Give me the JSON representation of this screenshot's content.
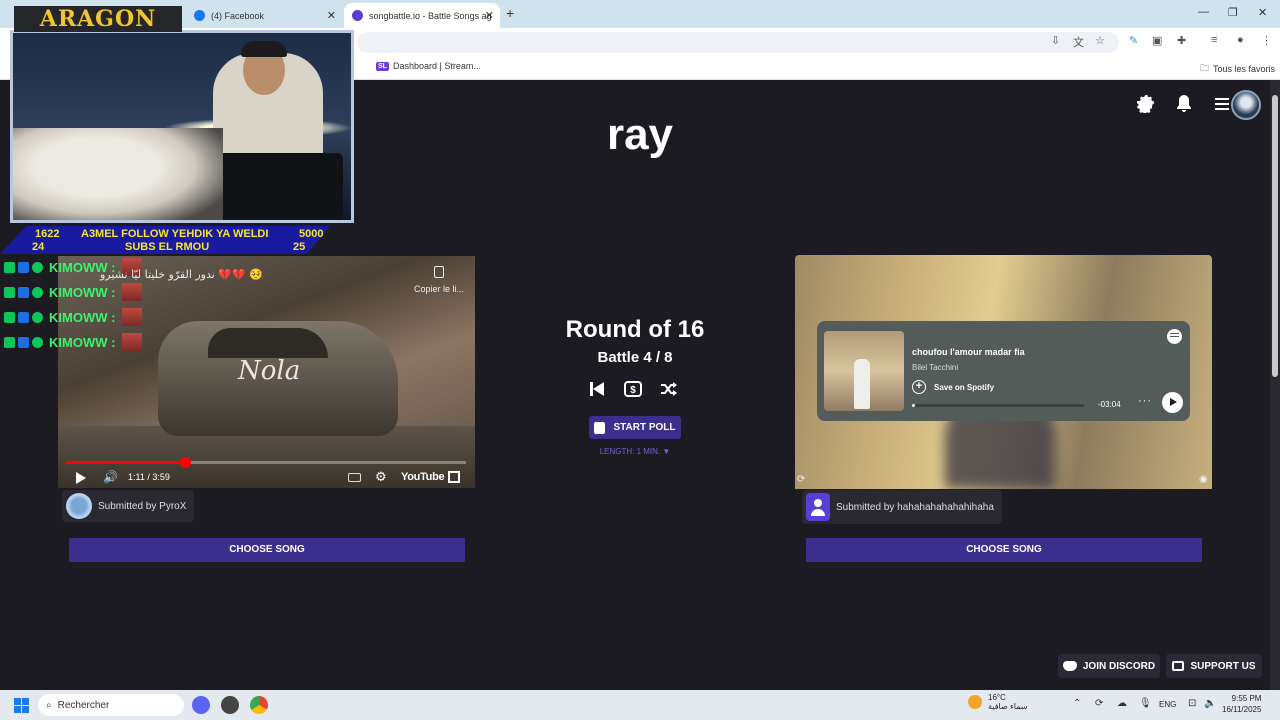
{
  "browser": {
    "tabs": [
      {
        "title": "(4) Facebook",
        "favicon_color": "#1877f2"
      },
      {
        "title": "songbattle.io - Battle Songs ag",
        "favicon_color": "#5a3fd6",
        "active": true
      }
    ],
    "new_tab": "+",
    "window_controls": {
      "minimize": "—",
      "maximize": "❐",
      "close": "✕"
    },
    "bookmarks": [
      {
        "label": "Dashboard | Stream...",
        "badge": "SL"
      }
    ],
    "all_bookmarks_label": "Tous les favoris"
  },
  "page": {
    "battle_title": "ray",
    "round_label": "Round of 16",
    "battle_label": "Battle 4 / 8",
    "start_poll_label": "START POLL",
    "length_label": "LENGTH: 1 MIN. ▼",
    "left_song": {
      "video_watermark": "Nola",
      "copy_link": "Copier le li...",
      "current_time": "1:11 / 3:59",
      "progress_fraction": 0.297,
      "player_brand": "YouTube",
      "submitted_by": "Submitted by PyroX",
      "choose_label": "CHOOSE SONG"
    },
    "right_song": {
      "track_title": "choufou l'amour madar fia",
      "artist": "Bilel Tacchini",
      "save_label": "Save on Spotify",
      "remaining_time": "-03:04",
      "progress_fraction": 0.02,
      "submitted_by": "Submitted by hahahahahahahihaha",
      "choose_label": "CHOOSE SONG"
    },
    "footer": {
      "join_discord": "JOIN DISCORD",
      "support_us": "SUPPORT US"
    },
    "colors": {
      "accent": "#3b2e8c",
      "background": "#1c1b22",
      "length_text": "#6b64d8"
    }
  },
  "overlay": {
    "brand": "ARAGON",
    "ticker": {
      "left_top": "1622",
      "center_top": "A3MEL FOLLOW YEHDIK YA WELDI",
      "right_top": "5000",
      "left_bottom": "24",
      "center_bottom": "SUBS EL RMOU",
      "right_bottom": "25"
    },
    "chat": [
      {
        "user": "KIMOWW :"
      },
      {
        "user": "KIMOWW :"
      },
      {
        "user": "KIMOWW :"
      },
      {
        "user": "KIMOWW :"
      }
    ],
    "chat_text": "ندور القرّو خليتا ليّا نشيرو 💔💔 🥺"
  },
  "taskbar": {
    "search_placeholder": "Rechercher",
    "weather_temp": "16°C",
    "weather_desc": "سماء صافية",
    "language": "ENG",
    "time": "9:55 PM",
    "date": "16/11/2025"
  }
}
